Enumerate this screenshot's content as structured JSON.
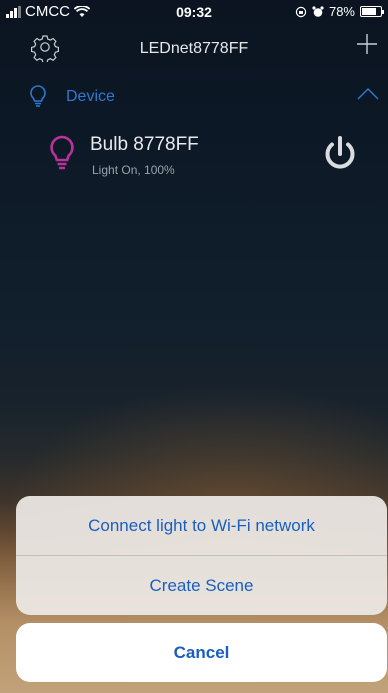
{
  "status_bar": {
    "carrier": "CMCC",
    "time": "09:32",
    "battery_percent": "78%",
    "battery_level": 0.78,
    "icons": [
      "signal-icon",
      "wifi-icon",
      "lock-rotation-icon",
      "alarm-icon",
      "battery-icon"
    ]
  },
  "nav": {
    "title": "LEDnet8778FF",
    "left_icon": "gear-icon",
    "right_icon": "plus-icon"
  },
  "section": {
    "label": "Device",
    "icon": "bulb-outline-icon",
    "toggle_icon": "chevron-up-icon"
  },
  "device": {
    "name": "Bulb 8778FF",
    "status": "Light On, 100%",
    "icon": "bulb-icon",
    "power_icon": "power-icon",
    "icon_color": "#b8329a"
  },
  "action_sheet": {
    "items": [
      {
        "label": "Connect light to Wi-Fi network"
      },
      {
        "label": "Create Scene"
      }
    ],
    "cancel_label": "Cancel"
  },
  "colors": {
    "accent": "#1a5fbf",
    "section_blue": "#2f78d2"
  }
}
